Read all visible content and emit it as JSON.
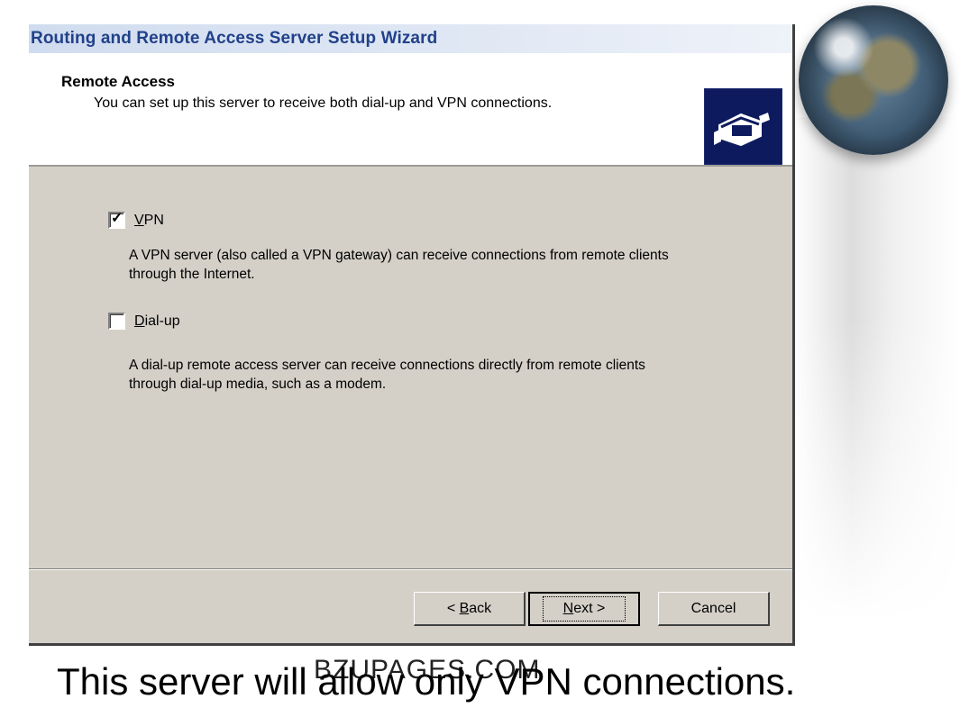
{
  "window": {
    "title": "Routing and Remote Access Server Setup Wizard"
  },
  "header": {
    "title": "Remote Access",
    "subtitle": "You can set up this server to receive both dial-up and VPN connections.",
    "icon": "network-connection-icon"
  },
  "options": {
    "vpn": {
      "label_mnemonic": "V",
      "label_rest": "PN",
      "checked": true,
      "description": "A VPN server (also called a VPN gateway) can receive connections from remote clients through the Internet."
    },
    "dialup": {
      "label_mnemonic": "D",
      "label_rest": "ial-up",
      "checked": false,
      "description": "A dial-up remote access server can receive connections directly from remote clients through dial-up media, such as a modem."
    }
  },
  "buttons": {
    "back_prefix": "< ",
    "back_mnemonic": "B",
    "back_rest": "ack",
    "next_mnemonic": "N",
    "next_rest": "ext >",
    "cancel": "Cancel"
  },
  "slide": {
    "caption": "This server will allow only VPN connections.",
    "watermark": "BZUPAGES.COM"
  },
  "colors": {
    "dialog_bg": "#d4d0c8",
    "title_text": "#21418a",
    "icon_bg": "#0d1b5e"
  }
}
